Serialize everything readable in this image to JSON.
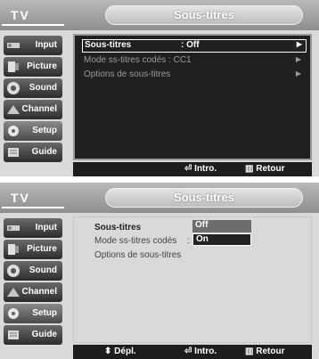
{
  "screen1": {
    "tv_label": "TV",
    "title": "Sous-titres",
    "sidebar": [
      "Input",
      "Picture",
      "Sound",
      "Channel",
      "Setup",
      "Guide"
    ],
    "menu": [
      {
        "label": "Sous-titres",
        "value": ": Off",
        "arrow": "▶"
      },
      {
        "label": "Mode ss-titres codés : CC1",
        "value": "",
        "arrow": "▶"
      },
      {
        "label": "Options de sous-titres",
        "value": "",
        "arrow": "▶"
      }
    ],
    "footer": {
      "enter": "Intro.",
      "return": "Retour"
    }
  },
  "screen2": {
    "tv_label": "TV",
    "title": "Sous-titres",
    "sidebar": [
      "Input",
      "Picture",
      "Sound",
      "Channel",
      "Setup",
      "Guide"
    ],
    "labels": [
      "Sous-titres",
      "Mode ss-titres codés",
      "Options de sous-titres"
    ],
    "colon1": ":",
    "colon2": ":",
    "options": {
      "off": "Off",
      "on": "On"
    },
    "footer": {
      "move": "Dépl.",
      "enter": "Intro.",
      "return": "Retour"
    }
  }
}
